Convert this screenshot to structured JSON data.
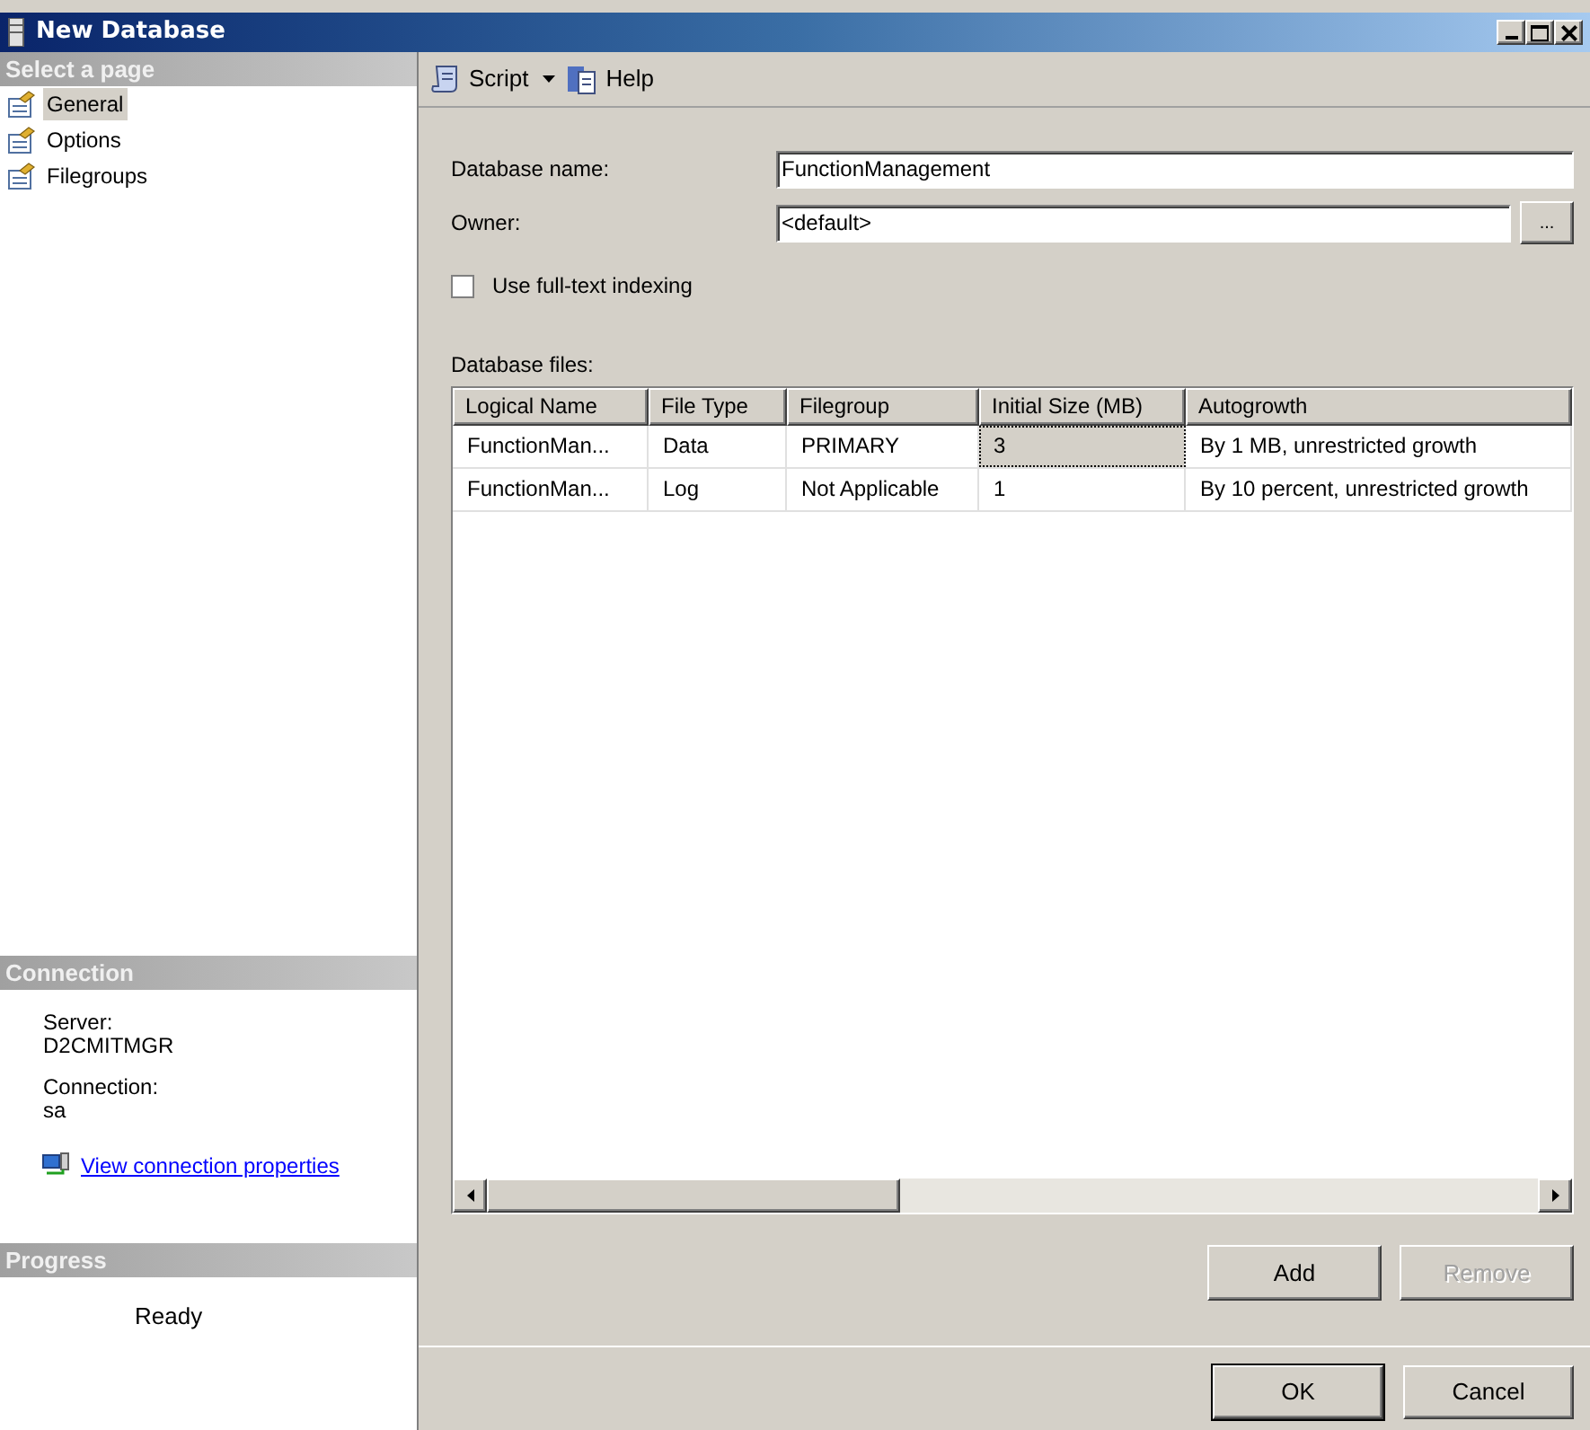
{
  "window": {
    "title": "New Database"
  },
  "sidebar": {
    "header": "Select a page",
    "pages": [
      {
        "label": "General",
        "selected": true
      },
      {
        "label": "Options",
        "selected": false
      },
      {
        "label": "Filegroups",
        "selected": false
      }
    ],
    "connection": {
      "header": "Connection",
      "server_label": "Server:",
      "server": "D2CMITMGR",
      "connection_label": "Connection:",
      "connection": "sa",
      "link": "View connection properties"
    },
    "progress": {
      "header": "Progress",
      "status": "Ready"
    }
  },
  "toolbar": [
    {
      "label": "Script",
      "kind": "menu"
    },
    {
      "label": "Help",
      "kind": "help"
    }
  ],
  "form": {
    "name_label": "Database name:",
    "name_value": "FunctionManagement",
    "owner_label": "Owner:",
    "owner_value": "<default>",
    "browse_button": "...",
    "fulltext": {
      "label": "Use full-text indexing",
      "checked": false
    }
  },
  "files": {
    "label": "Database files:",
    "columns": [
      "Logical Name",
      "File Type",
      "Filegroup",
      "Initial Size (MB)",
      "Autogrowth"
    ],
    "rows": [
      {
        "cells": [
          {
            "text": "FunctionMan...",
            "focused": false
          },
          {
            "text": "Data",
            "focused": false
          },
          {
            "text": "PRIMARY",
            "focused": false
          },
          {
            "text": "3",
            "focused": true
          },
          {
            "text": "By 1 MB, unrestricted growth",
            "focused": false
          }
        ]
      },
      {
        "cells": [
          {
            "text": "FunctionMan...",
            "focused": false
          },
          {
            "text": "Log",
            "focused": false
          },
          {
            "text": "Not Applicable",
            "focused": false
          },
          {
            "text": "1",
            "focused": false
          },
          {
            "text": "By 10 percent, unrestricted growth",
            "focused": false
          }
        ]
      }
    ],
    "buttons": [
      {
        "label": "Add",
        "disabled": false
      },
      {
        "label": "Remove",
        "disabled": true
      }
    ]
  },
  "dialog_buttons": [
    {
      "label": "OK",
      "default": true
    },
    {
      "label": "Cancel",
      "default": false
    }
  ]
}
